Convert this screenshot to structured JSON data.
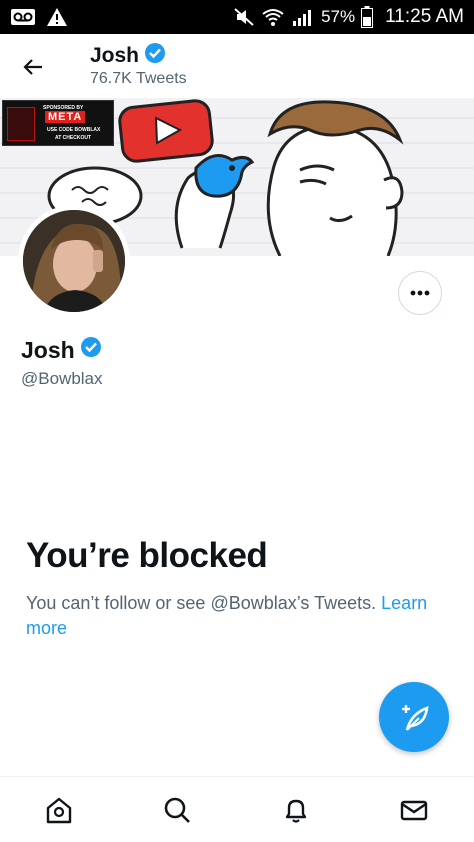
{
  "status_bar": {
    "battery_percent": "57%",
    "time": "11:25 AM",
    "icons": [
      "voicemail-icon",
      "warning-icon",
      "mute-icon",
      "wifi-icon",
      "signal-icon",
      "battery-icon"
    ]
  },
  "header": {
    "name": "Josh",
    "tweet_count": "76.7K Tweets"
  },
  "banner": {
    "sponsor_line1": "SPONSORED BY",
    "sponsor_brand": "META",
    "sponsor_line2": "USE CODE BOWBLAX",
    "sponsor_line3": "AT CHECKOUT"
  },
  "profile": {
    "name": "Josh",
    "handle": "@Bowblax",
    "verified": true
  },
  "blocked": {
    "title": "You’re blocked",
    "message": "You can’t follow or see @Bowblax’s Tweets.",
    "link": "Learn more"
  },
  "colors": {
    "accent": "#1d9bf0",
    "text_primary": "#0f1419",
    "text_secondary": "#536471"
  },
  "bottom_nav": [
    "home-icon",
    "search-icon",
    "notifications-icon",
    "messages-icon"
  ]
}
